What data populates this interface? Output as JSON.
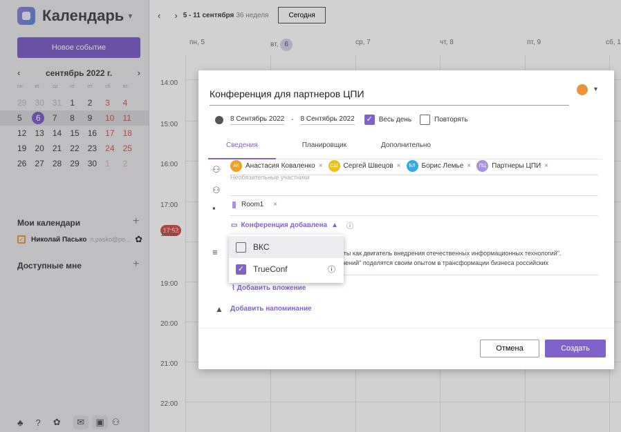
{
  "sidebar": {
    "title": "Календарь",
    "new_event": "Новое событие",
    "month_title": "сентябрь 2022 г.",
    "weekdays": [
      "пн",
      "вт",
      "ср",
      "чт",
      "пт",
      "сб",
      "вс"
    ],
    "weeks": [
      [
        "29",
        "30",
        "31",
        "1",
        "2",
        "3",
        "4"
      ],
      [
        "5",
        "6",
        "7",
        "8",
        "9",
        "10",
        "11"
      ],
      [
        "12",
        "13",
        "14",
        "15",
        "16",
        "17",
        "18"
      ],
      [
        "19",
        "20",
        "21",
        "22",
        "23",
        "24",
        "25"
      ],
      [
        "26",
        "27",
        "28",
        "29",
        "30",
        "1",
        "2"
      ]
    ],
    "my_calendars": "Мои календари",
    "calendar_name": "Николай Пасько",
    "calendar_email": "n.pasko@po...",
    "available": "Доступные мне"
  },
  "toolbar": {
    "range": "5 - 11 сентября",
    "week": "36 неделя",
    "today": "Сегодня"
  },
  "days": [
    {
      "label": "пн, 5"
    },
    {
      "label": "вт,",
      "num": "6"
    },
    {
      "label": "ср, 7"
    },
    {
      "label": "чт, 8"
    },
    {
      "label": "пт, 9"
    },
    {
      "label": "сб, 1"
    }
  ],
  "hours": [
    "14:00",
    "15:00",
    "16:00",
    "17:00",
    "18:00",
    "19:00",
    "20:00",
    "21:00",
    "22:00"
  ],
  "now": "17:52",
  "dialog": {
    "title": "Конференция для партнеров ЦПИ",
    "date_from": "8 Сентябрь 2022",
    "dash": "-",
    "date_to": "8 Сентябрь 2022",
    "all_day": "Весь день",
    "repeat": "Повторять",
    "tabs": [
      "Сведения",
      "Планировщик",
      "Дополнительно"
    ],
    "participants": [
      {
        "initials": "АК",
        "name": "Анастасия Коваленко",
        "color": "#f0a020"
      },
      {
        "initials": "СШ",
        "name": "Сергей Швецов",
        "color": "#e8c21a"
      },
      {
        "initials": "БЛ",
        "name": "Борис Лемье",
        "color": "#35a9e0"
      },
      {
        "initials": "ПЦ",
        "name": "Партнеры ЦПИ",
        "color": "#a98fe0"
      }
    ],
    "optional_placeholder": "Необязательные участники",
    "room": "Room1",
    "conference": "Конференция добавлена",
    "description_line1": "дукты как двигатель внедрения отечественных информационных технологий\".",
    "description_line2": "менений\" поделятся своим опытом в трансформации бизнеса российских",
    "add_attachment": "Добавить вложение",
    "add_reminder": "Добавить напоминание",
    "cancel": "Отмена",
    "create": "Создать"
  },
  "dropdown": {
    "items": [
      {
        "label": "ВКС",
        "checked": false
      },
      {
        "label": "TrueConf",
        "checked": true
      }
    ]
  },
  "colors": {
    "accent": "#8063c8",
    "event_color": "#f0913f",
    "now": "#d9534f"
  }
}
